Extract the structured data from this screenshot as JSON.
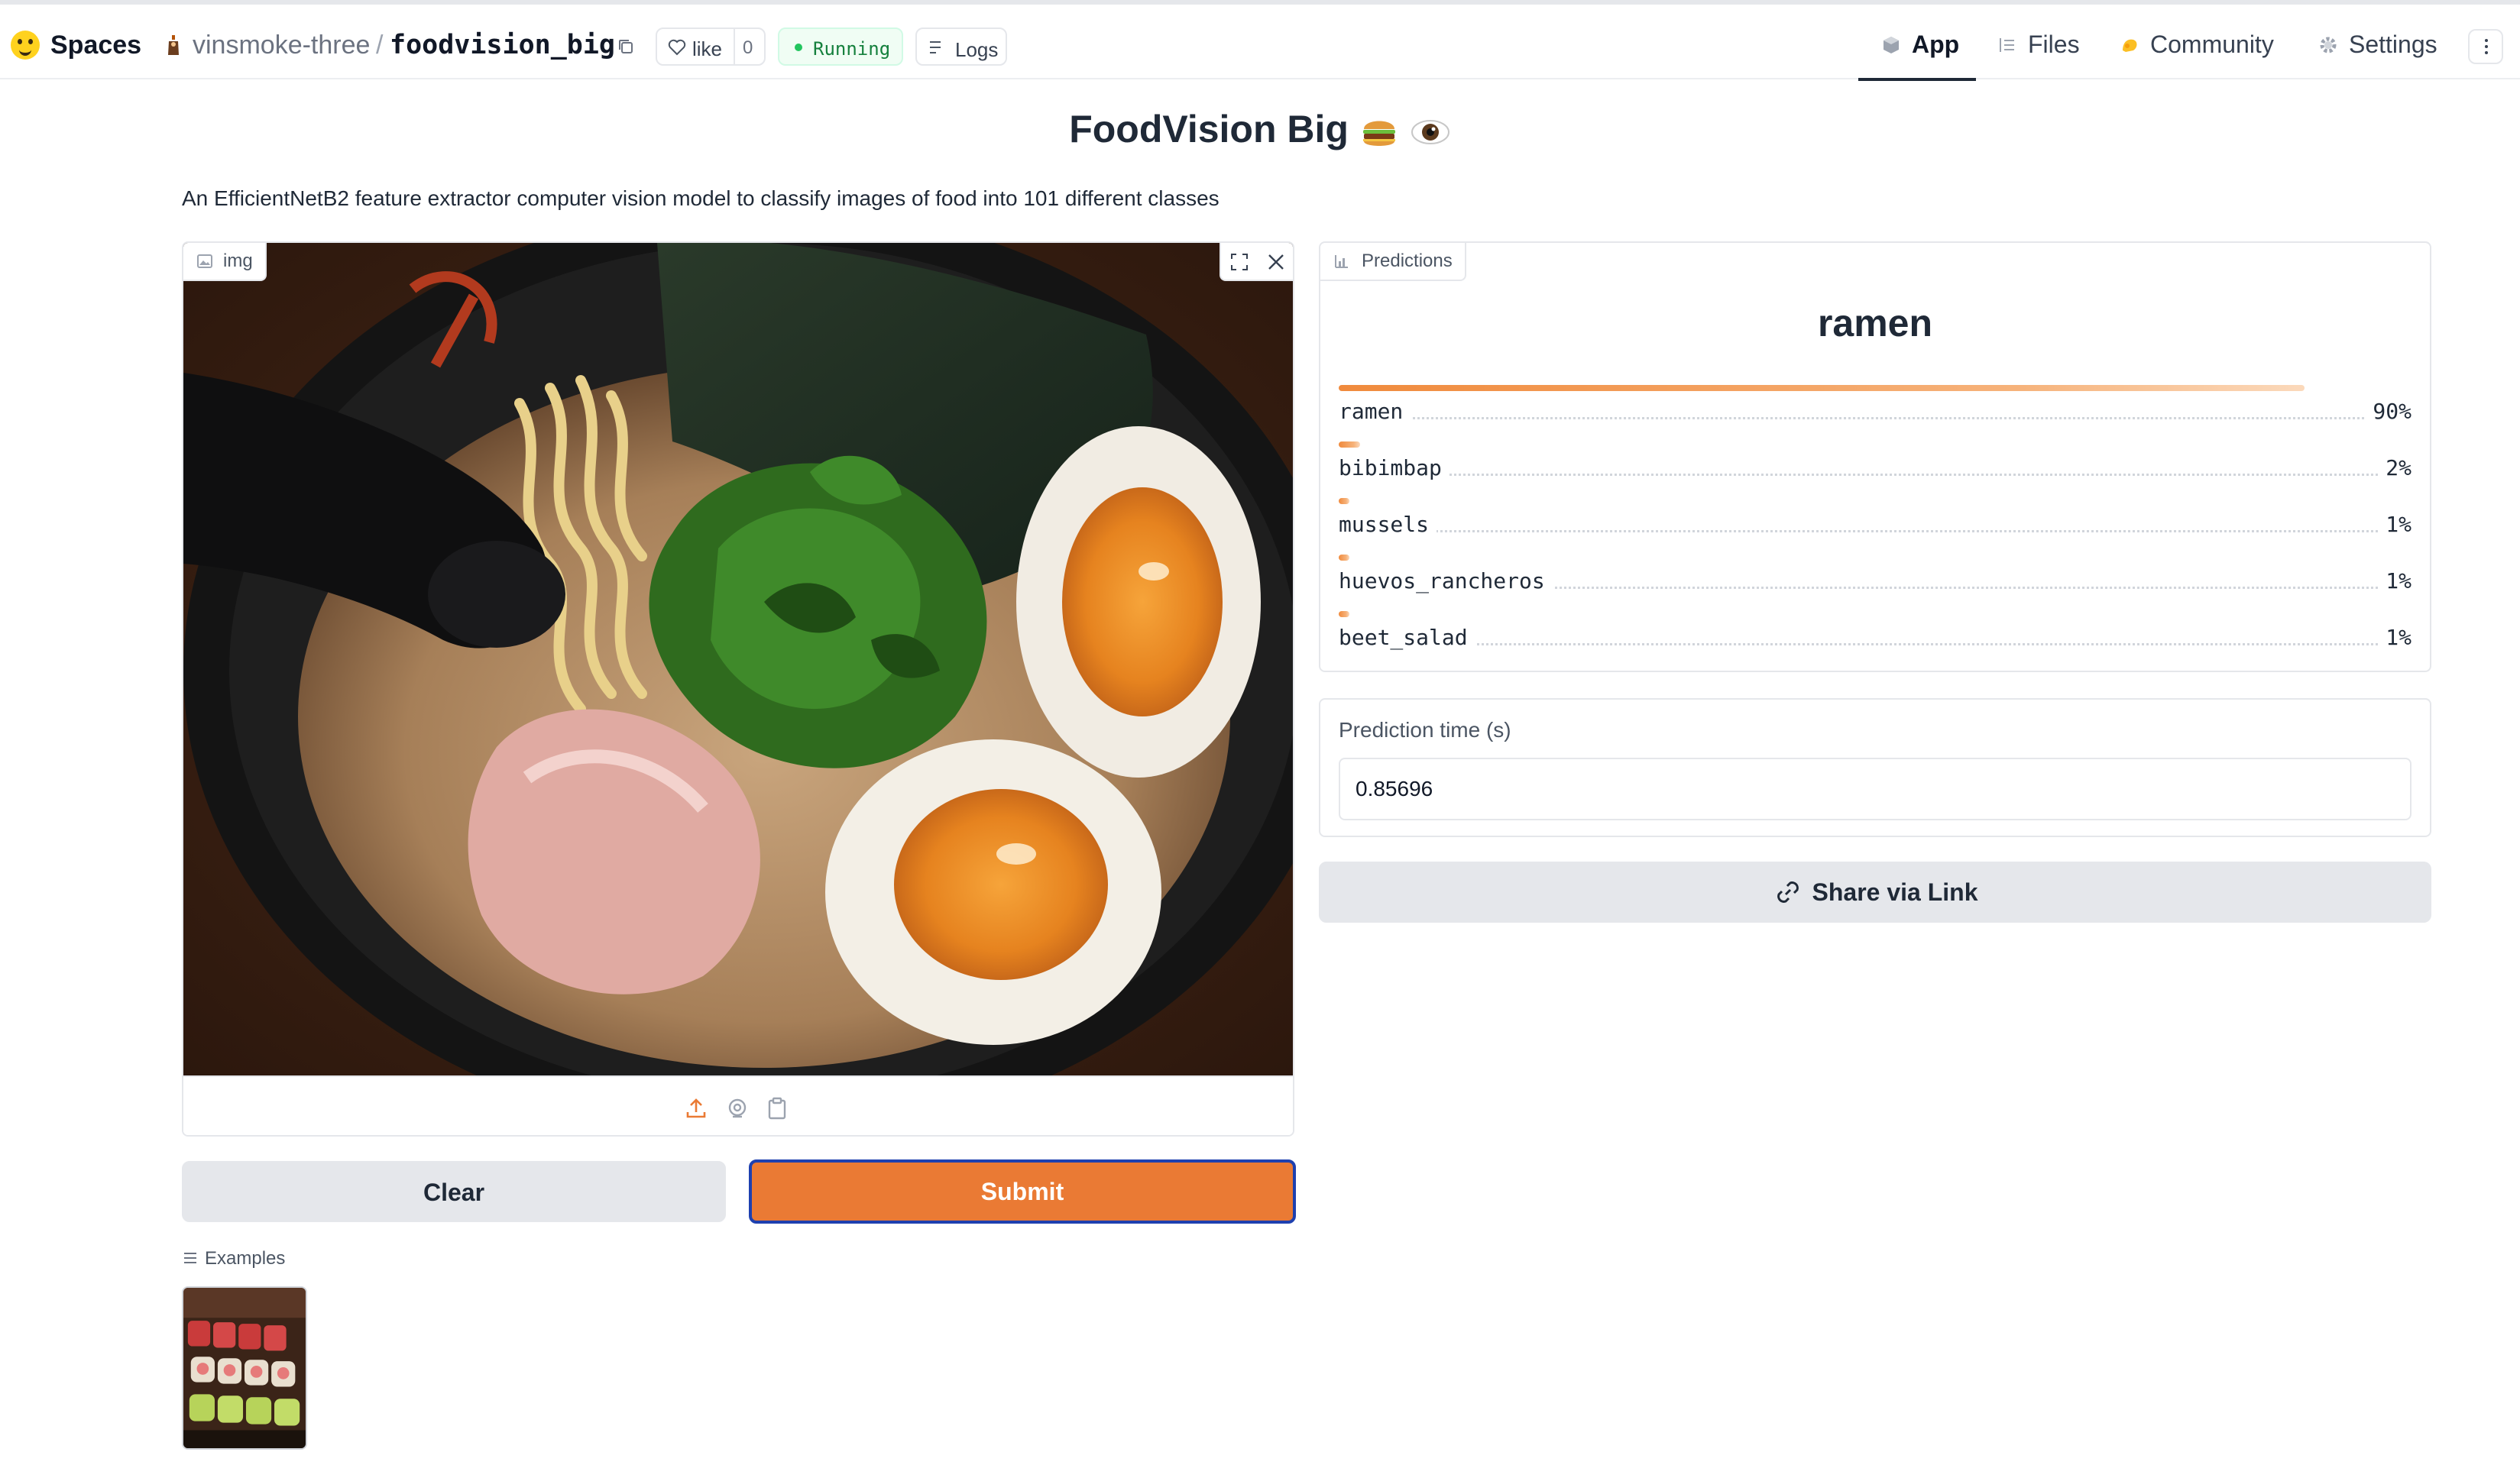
{
  "header": {
    "spaces_label": "Spaces",
    "owner": "vinsmoke-three",
    "separator": "/",
    "repo": "foodvision_big",
    "like_label": "like",
    "like_count": "0",
    "status": "Running",
    "logs_label": "Logs",
    "nav": [
      {
        "label": "App",
        "icon": "cube-icon",
        "active": true
      },
      {
        "label": "Files",
        "icon": "files-icon"
      },
      {
        "label": "Community",
        "icon": "community-icon"
      },
      {
        "label": "Settings",
        "icon": "gear-icon"
      }
    ]
  },
  "main": {
    "title": "FoodVision Big",
    "title_emojis": [
      "hamburger",
      "eye"
    ],
    "description": "An EfficientNetB2 feature extractor computer vision model to classify images of food into 101 different classes"
  },
  "input": {
    "label": "img",
    "image_subject": "bowl of ramen",
    "clear_label": "Clear",
    "submit_label": "Submit",
    "examples_label": "Examples"
  },
  "predictions": {
    "label": "Predictions",
    "top_label": "ramen",
    "items": [
      {
        "name": "ramen",
        "pct": "90%",
        "value": 0.9
      },
      {
        "name": "bibimbap",
        "pct": "2%",
        "value": 0.02
      },
      {
        "name": "mussels",
        "pct": "1%",
        "value": 0.01
      },
      {
        "name": "huevos_rancheros",
        "pct": "1%",
        "value": 0.01
      },
      {
        "name": "beet_salad",
        "pct": "1%",
        "value": 0.01
      }
    ]
  },
  "time": {
    "label": "Prediction time (s)",
    "value": "0.85696"
  },
  "share": {
    "label": "Share via Link"
  },
  "colors": {
    "accent": "#ea7a34",
    "running": "#22c55e",
    "focus_border": "#1e40af"
  }
}
